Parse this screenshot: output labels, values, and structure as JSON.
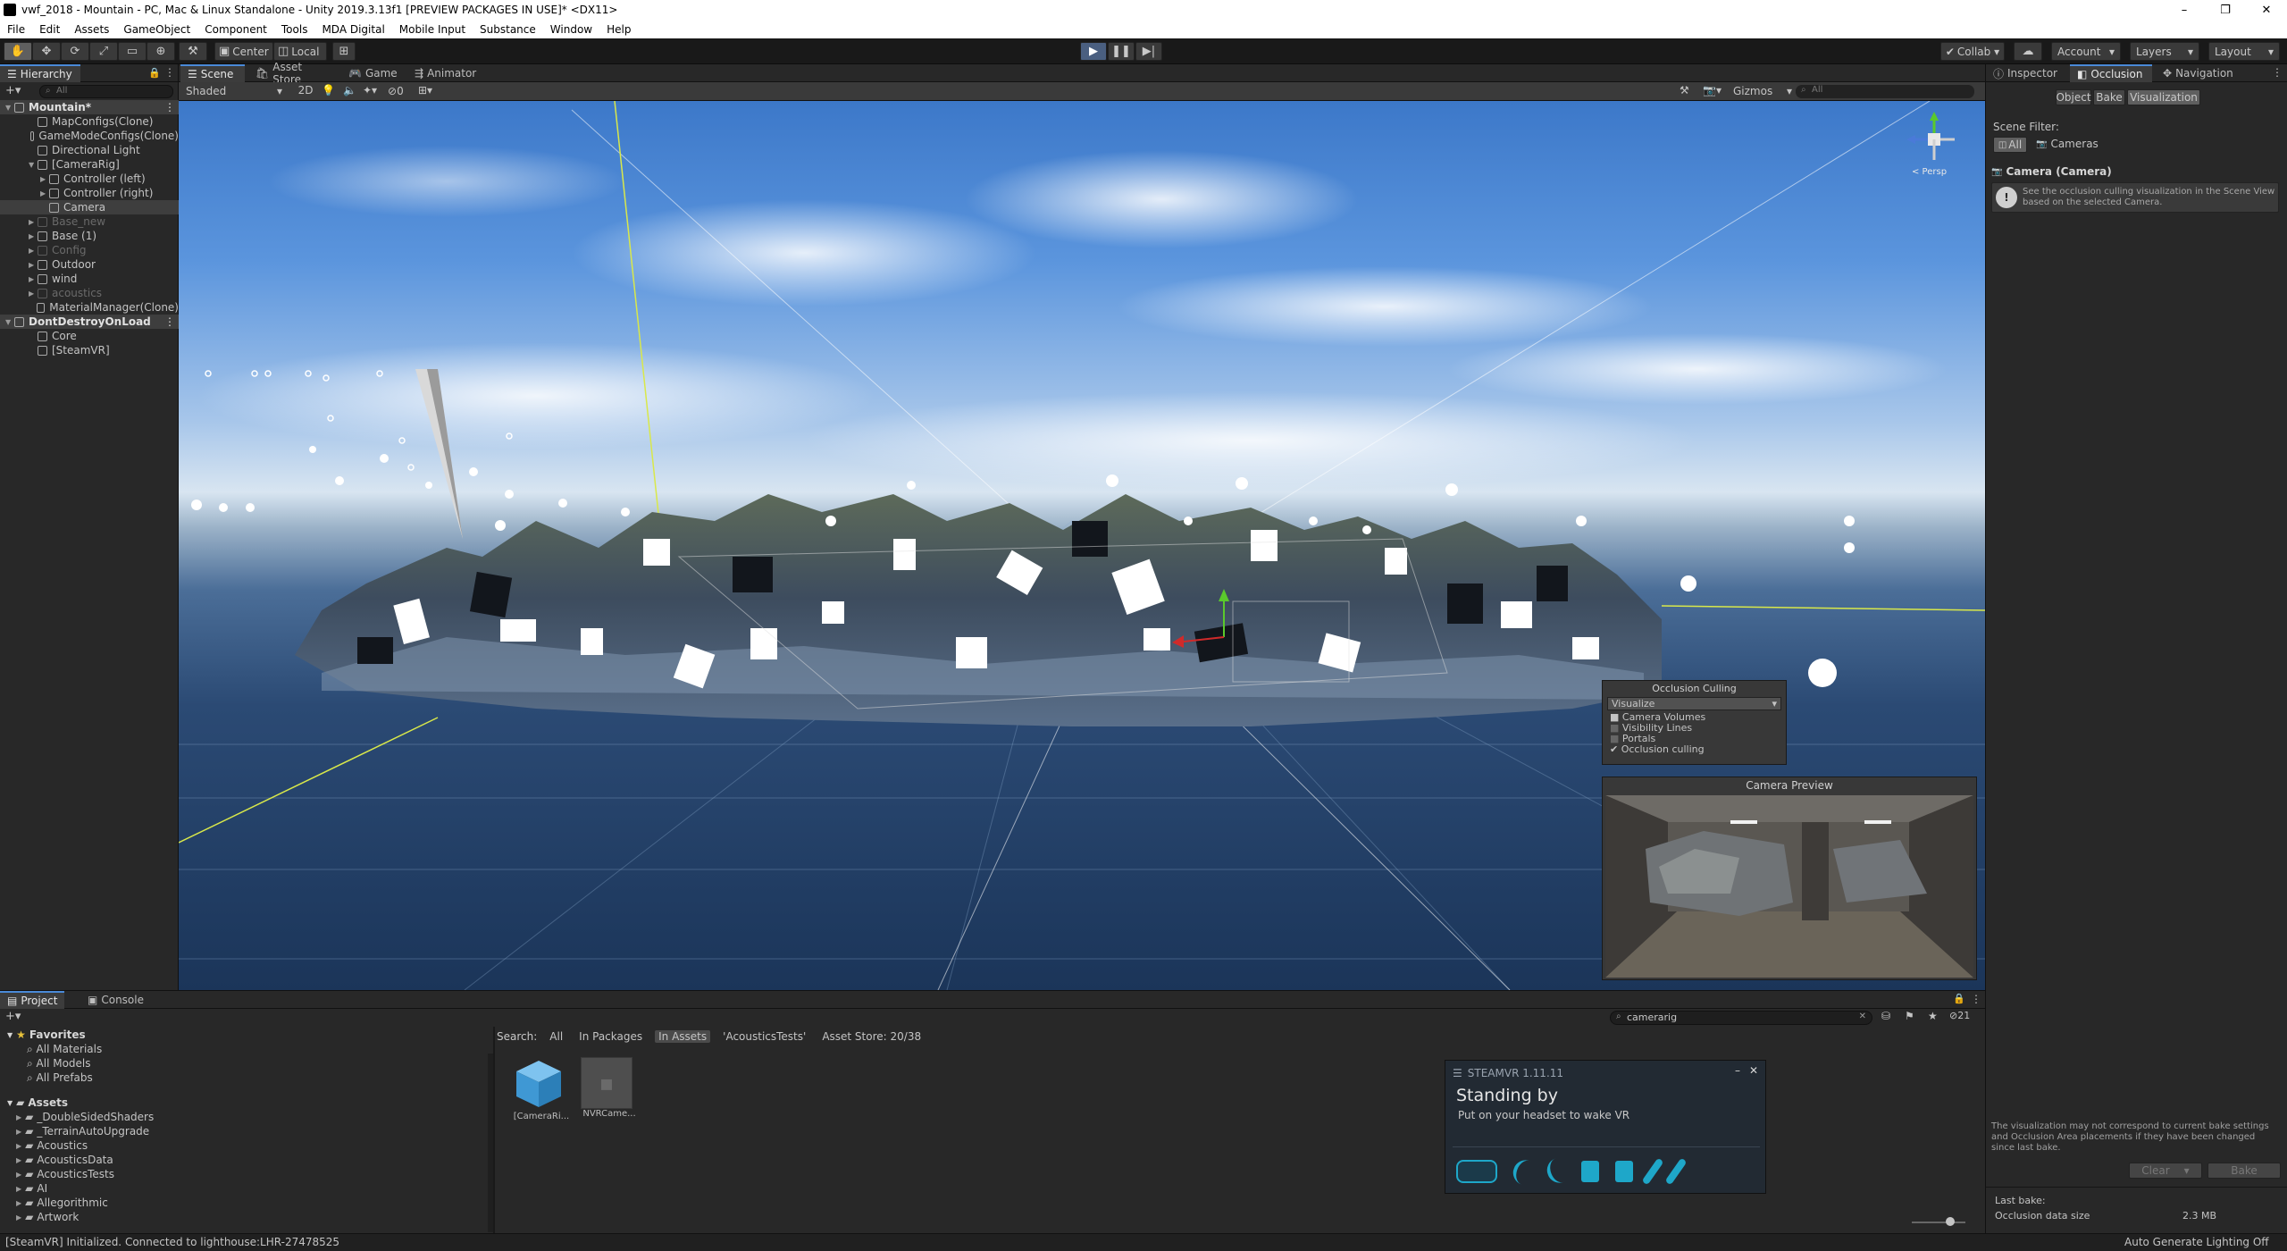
{
  "titlebar": {
    "title": "vwf_2018 - Mountain - PC, Mac & Linux Standalone - Unity 2019.3.13f1 [PREVIEW PACKAGES IN USE]* <DX11>",
    "minimize": "–",
    "maximize": "❐",
    "close": "✕"
  },
  "menu": [
    "File",
    "Edit",
    "Assets",
    "GameObject",
    "Component",
    "Tools",
    "MDA Digital",
    "Mobile Input",
    "Substance",
    "Window",
    "Help"
  ],
  "toolbar": {
    "center_label": "Center",
    "local_label": "Local",
    "collab_label": "Collab ▾",
    "account_label": "Account",
    "layers_label": "Layers",
    "layout_label": "Layout"
  },
  "hierarchy": {
    "tab_label": "Hierarchy",
    "search_placeholder": "All",
    "items": [
      {
        "label": "Mountain*",
        "indent": 0,
        "kind": "scene"
      },
      {
        "label": "MapConfigs(Clone)",
        "indent": 2,
        "kind": "normal"
      },
      {
        "label": "GameModeConfigs(Clone)",
        "indent": 2,
        "kind": "normal"
      },
      {
        "label": "Directional Light",
        "indent": 2,
        "kind": "normal"
      },
      {
        "label": "[CameraRig]",
        "indent": 2,
        "kind": "open"
      },
      {
        "label": "Controller (left)",
        "indent": 3,
        "kind": "closed"
      },
      {
        "label": "Controller (right)",
        "indent": 3,
        "kind": "closed"
      },
      {
        "label": "Camera",
        "indent": 3,
        "kind": "selected"
      },
      {
        "label": "Base_new",
        "indent": 2,
        "kind": "dim"
      },
      {
        "label": "Base (1)",
        "indent": 2,
        "kind": "closed"
      },
      {
        "label": "Config",
        "indent": 2,
        "kind": "dim"
      },
      {
        "label": "Outdoor",
        "indent": 2,
        "kind": "closed"
      },
      {
        "label": "wind",
        "indent": 2,
        "kind": "closed"
      },
      {
        "label": "acoustics",
        "indent": 2,
        "kind": "dim"
      },
      {
        "label": "MaterialManager(Clone)",
        "indent": 2,
        "kind": "normal"
      },
      {
        "label": "DontDestroyOnLoad",
        "indent": 0,
        "kind": "scene"
      },
      {
        "label": "Core",
        "indent": 2,
        "kind": "normal"
      },
      {
        "label": "[SteamVR]",
        "indent": 2,
        "kind": "normal"
      }
    ]
  },
  "scene_tabs": [
    {
      "label": "Scene",
      "icon": "scene-icon"
    },
    {
      "label": "Asset Store",
      "icon": "asset-store-icon"
    },
    {
      "label": "Game",
      "icon": "game-icon"
    },
    {
      "label": "Animator",
      "icon": "animator-icon"
    }
  ],
  "scene_toolbar": {
    "shading_mode": "Shaded",
    "two_d": "2D",
    "fx_count": "0",
    "gizmos_label": "Gizmos",
    "search_placeholder": "All",
    "persp_label": "< Persp"
  },
  "occlusion_overlay": {
    "title": "Occlusion Culling",
    "mode": "Visualize",
    "options": [
      "Camera Volumes",
      "Visibility Lines",
      "Portals"
    ],
    "toggle_label": "Occlusion culling"
  },
  "camera_preview": {
    "title": "Camera Preview"
  },
  "inspector": {
    "tabs": [
      "Inspector",
      "Occlusion",
      "Navigation"
    ],
    "modes": [
      "Object",
      "Bake",
      "Visualization"
    ],
    "scene_filter_label": "Scene Filter:",
    "filter_all": "All",
    "filter_cameras": "Cameras",
    "camera_title": "Camera (Camera)",
    "help_text": "See the occlusion culling visualization in the Scene View based on the selected Camera.",
    "warning_text": "The visualization may not correspond to current bake settings and Occlusion Area placements if they have been changed since last bake.",
    "clear_label": "Clear",
    "bake_label": "Bake",
    "last_bake_label": "Last bake:",
    "occlusion_size_label": "Occlusion data size",
    "occlusion_size_value": "2.3 MB"
  },
  "project": {
    "tabs": [
      "Project",
      "Console"
    ],
    "favorites_label": "Favorites",
    "favorites": [
      "All Materials",
      "All Models",
      "All Prefabs"
    ],
    "assets_label": "Assets",
    "assets": [
      "_DoubleSidedShaders",
      "_TerrainAutoUpgrade",
      "Acoustics",
      "AcousticsData",
      "AcousticsTests",
      "AI",
      "Allegorithmic",
      "Artwork"
    ],
    "search_value": "camerarig",
    "search_label": "Search:",
    "search_scopes": [
      "All",
      "In Packages",
      "In Assets",
      "'AcousticsTests'",
      "Asset Store: 20/38"
    ],
    "hidden_count": "21",
    "files": [
      {
        "label": "[CameraRi...",
        "icon": "prefab-cube-icon"
      },
      {
        "label": "NVRCame...",
        "icon": "missing-prefab-icon"
      }
    ]
  },
  "steamvr": {
    "header": "STEAMVR 1.11.11",
    "status": "Standing by",
    "hint": "Put on your headset to wake VR",
    "devices": [
      "headset-icon",
      "controller-icon",
      "controller-icon",
      "base-station-icon",
      "base-station-icon",
      "tracker-icon",
      "tracker-icon"
    ]
  },
  "statusbar": {
    "message": "[SteamVR] Initialized. Connected to lighthouse:LHR-27478525",
    "lighting": "Auto Generate Lighting Off"
  },
  "colors": {
    "accent": "#4a8ad8",
    "editor_bg": "#282828",
    "sky_top": "#3c78c9",
    "ocean": "#1b3559"
  }
}
